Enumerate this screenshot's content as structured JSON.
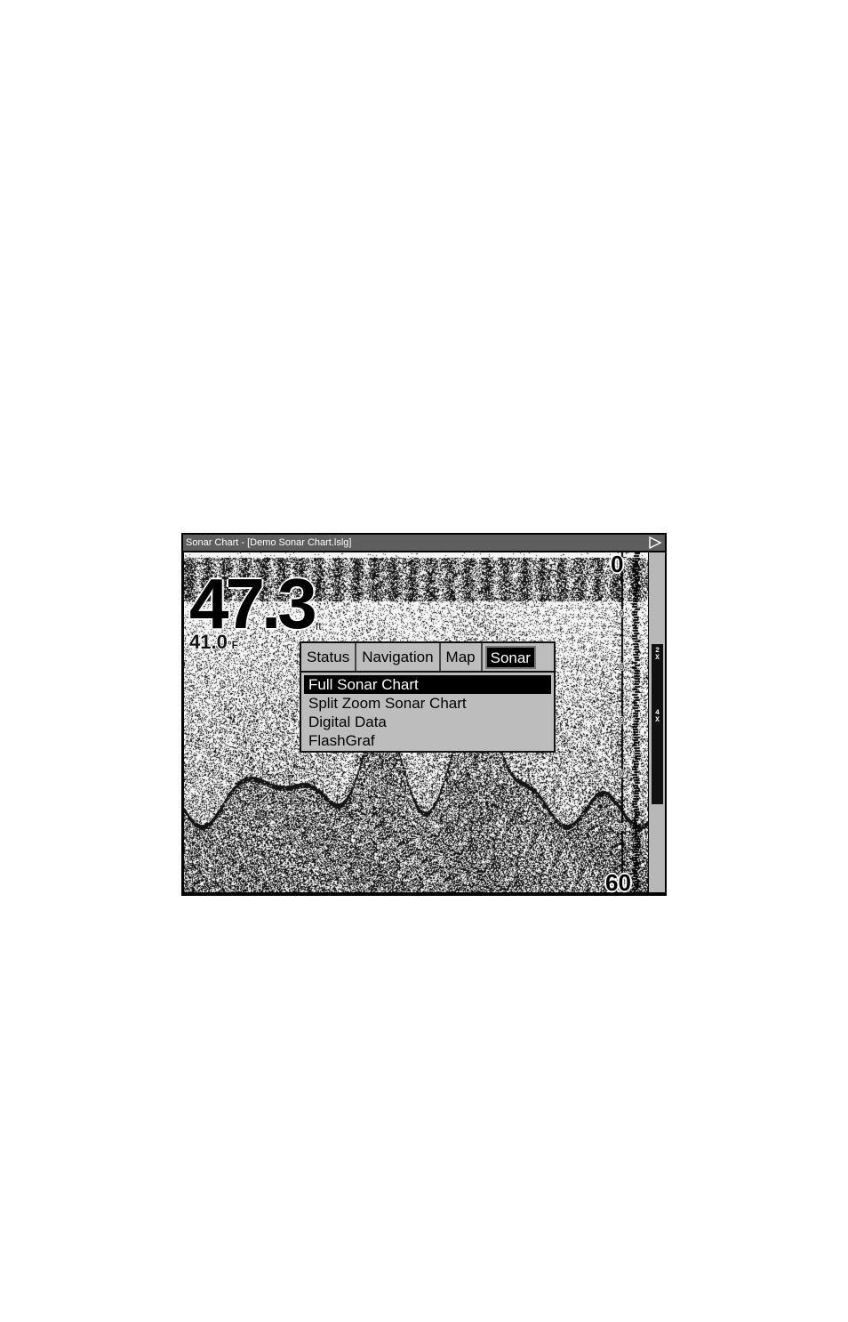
{
  "window": {
    "title": "Sonar Chart - [Demo Sonar Chart.lslg]"
  },
  "display": {
    "depth_value": "47.3",
    "depth_unit": "ft",
    "temperature_value": "41.0",
    "temperature_unit": "°F"
  },
  "menu": {
    "tabs": [
      {
        "label": "Status",
        "active": false
      },
      {
        "label": "Navigation",
        "active": false
      },
      {
        "label": "Map",
        "active": false
      },
      {
        "label": "Sonar",
        "active": true
      }
    ],
    "items": [
      {
        "label": "Full Sonar Chart",
        "selected": true
      },
      {
        "label": "Split Zoom Sonar Chart",
        "selected": false
      },
      {
        "label": "Digital Data",
        "selected": false
      },
      {
        "label": "FlashGraf",
        "selected": false
      }
    ]
  },
  "depth_scale": {
    "top": "0",
    "bottom": "60",
    "ticks": [
      "10",
      "20",
      "30",
      "40",
      "50"
    ]
  },
  "zoom_bar": {
    "labels": [
      "2X",
      "4X"
    ]
  },
  "icons": {
    "play": "play-triangle-icon"
  }
}
